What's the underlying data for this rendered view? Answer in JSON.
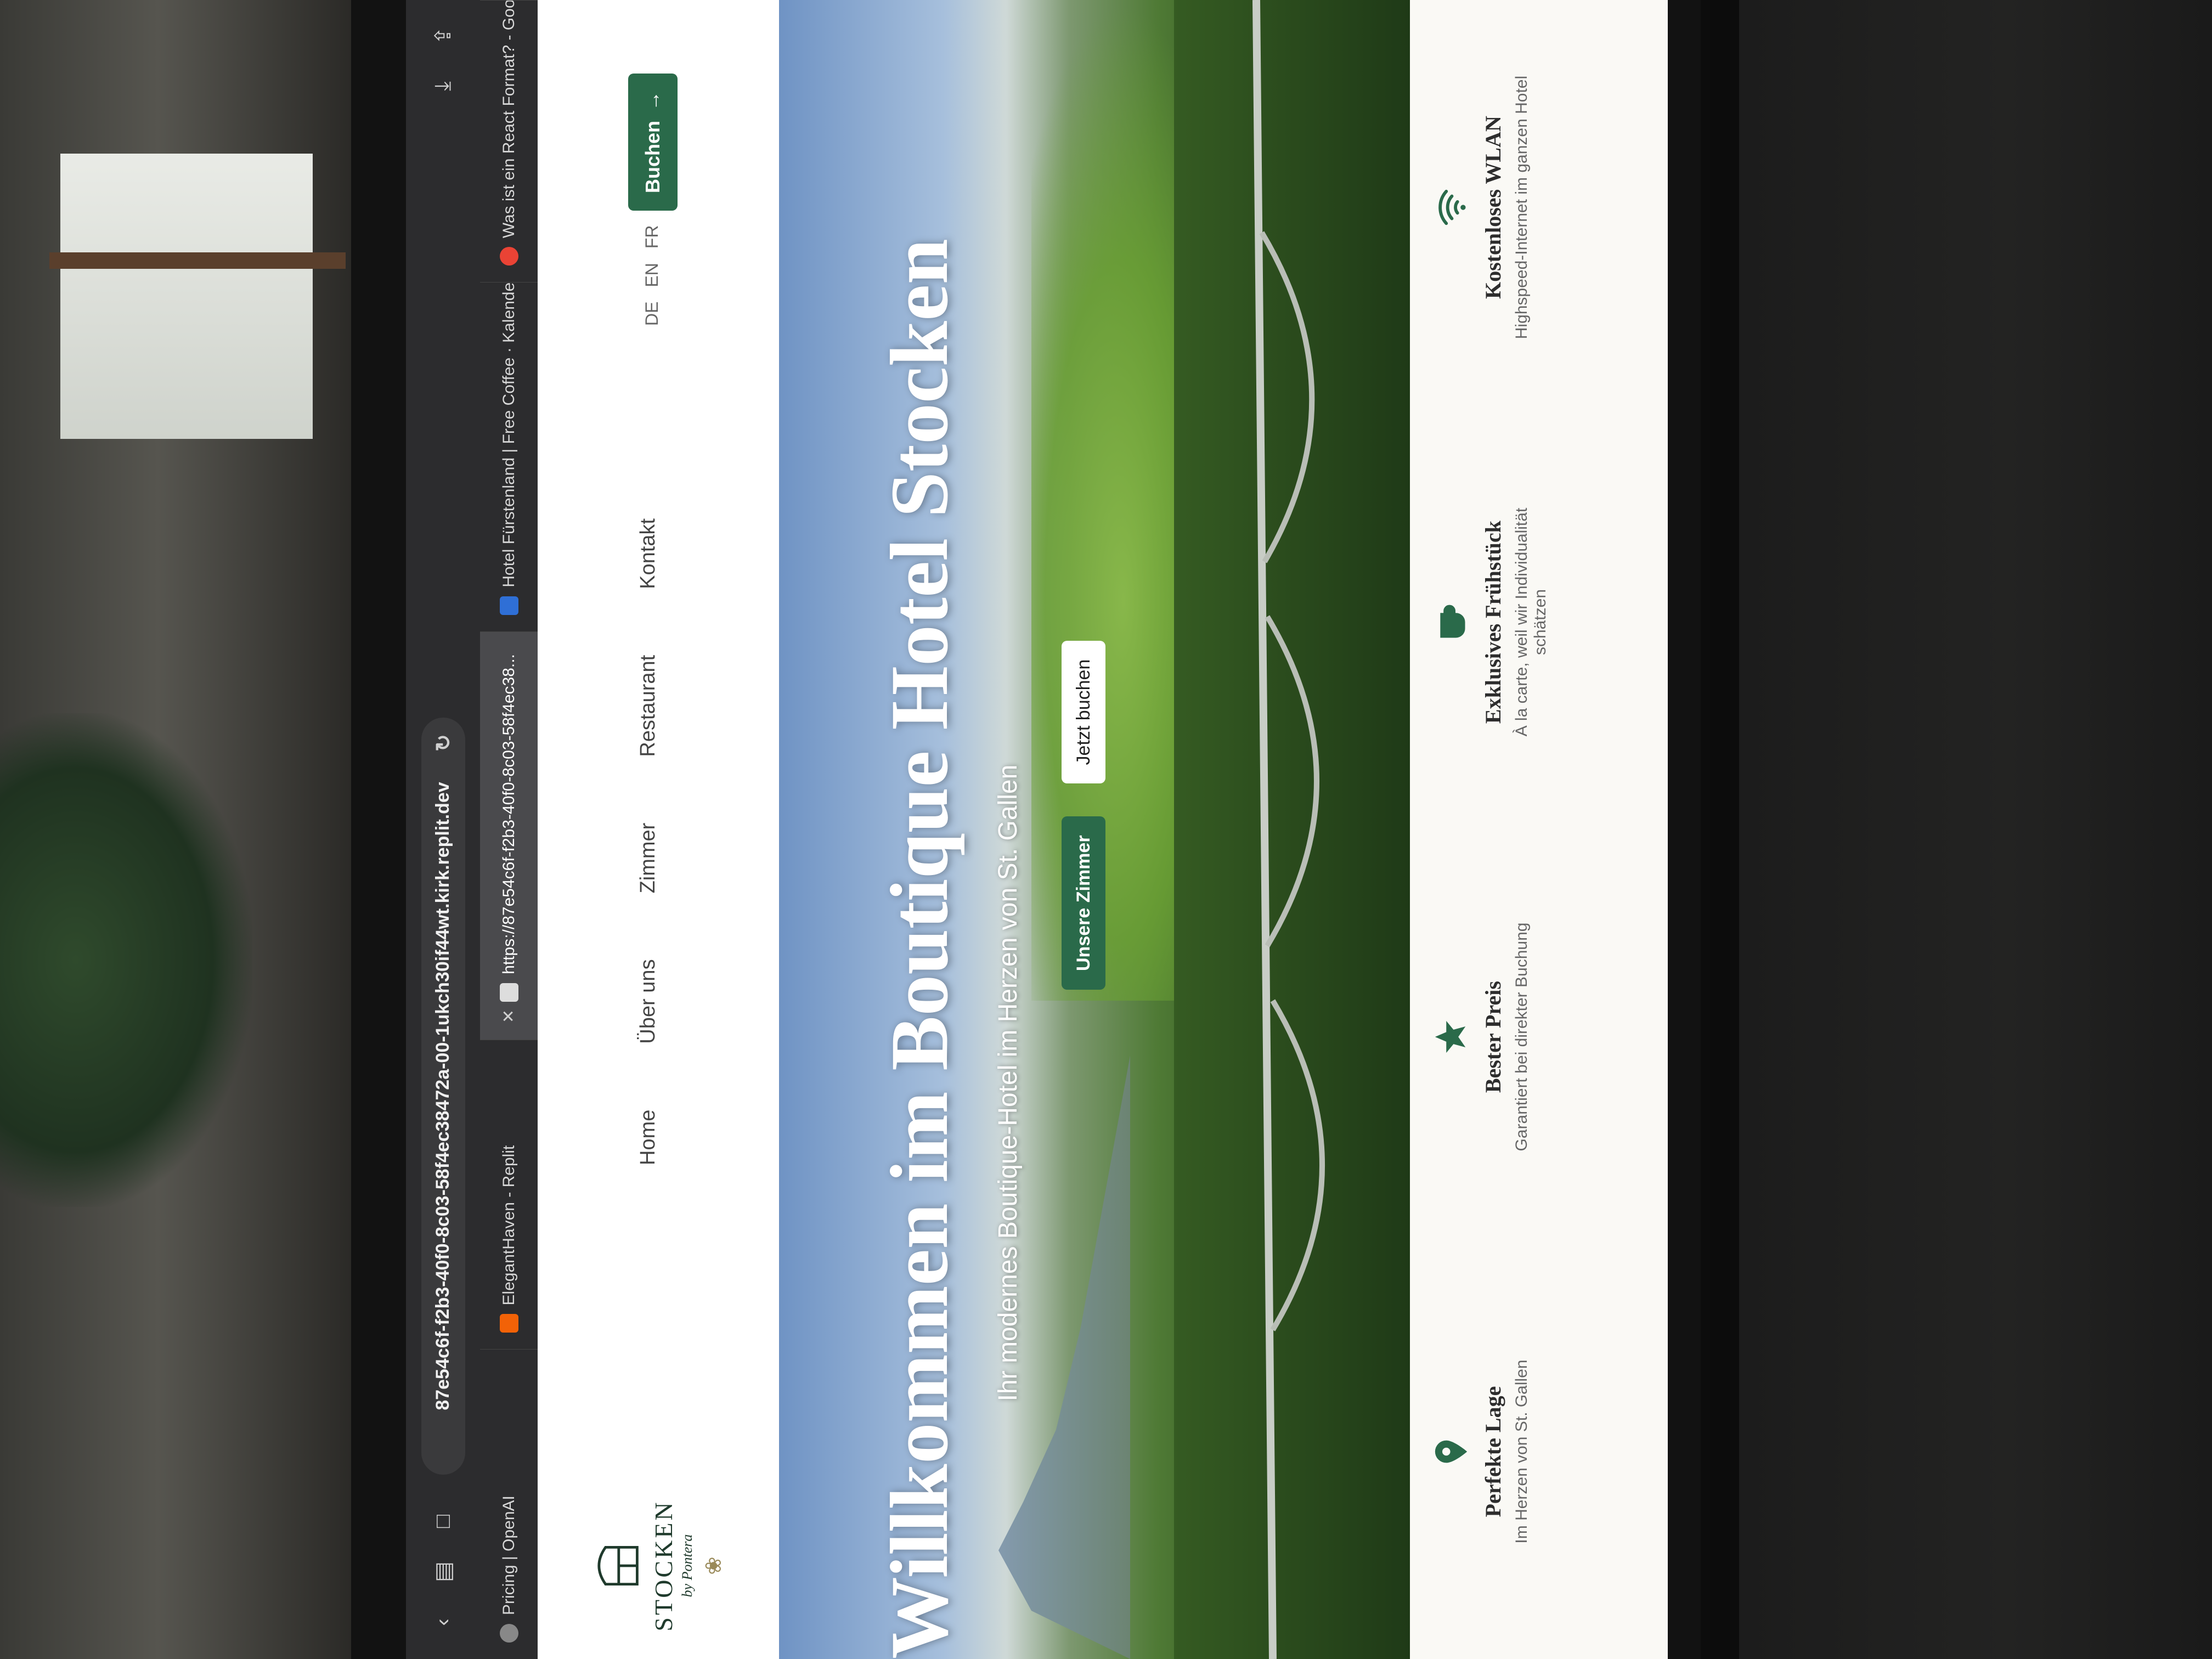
{
  "browser": {
    "url": "87e54c6f-f2b3-40f0-8c03-58f4ec38472a-00-1ukch30if44wt.kirk.replit.dev",
    "tabs": [
      {
        "label": "Pricing | OpenAI",
        "active": false
      },
      {
        "label": "ElegantHaven - Replit",
        "active": false
      },
      {
        "label": "https://87e54c6f-f2b3-40f0-8c03-58f4ec38...",
        "active": true
      },
      {
        "label": "Hotel Fürstenland | Free Coffee · Kalender",
        "active": false
      },
      {
        "label": "Was ist ein React Format? - Goo",
        "active": false
      }
    ]
  },
  "site": {
    "logo": {
      "name": "STOCKEN",
      "sub": "by Pontera"
    },
    "nav": [
      "Home",
      "Über uns",
      "Zimmer",
      "Restaurant",
      "Kontakt"
    ],
    "languages": [
      "DE",
      "EN",
      "FR"
    ],
    "book_label": "Buchen",
    "hero": {
      "title": "Willkommen im Boutique Hotel Stocken",
      "subtitle": "Ihr modernes Boutique-Hotel im Herzen von St. Gallen",
      "primary_button": "Unsere Zimmer",
      "secondary_button": "Jetzt buchen"
    },
    "features": [
      {
        "icon": "location-pin-icon",
        "title": "Perfekte Lage",
        "desc": "Im Herzen von St. Gallen"
      },
      {
        "icon": "star-icon",
        "title": "Bester Preis",
        "desc": "Garantiert bei direkter Buchung"
      },
      {
        "icon": "coffee-cup-icon",
        "title": "Exklusives Frühstück",
        "desc": "À la carte, weil wir Individualität schätzen"
      },
      {
        "icon": "wifi-icon",
        "title": "Kostenloses WLAN",
        "desc": "Highspeed-Internet im ganzen Hotel"
      }
    ]
  },
  "colors": {
    "brand_green": "#2a6a4a",
    "browser_chrome": "#2c2c2e"
  }
}
